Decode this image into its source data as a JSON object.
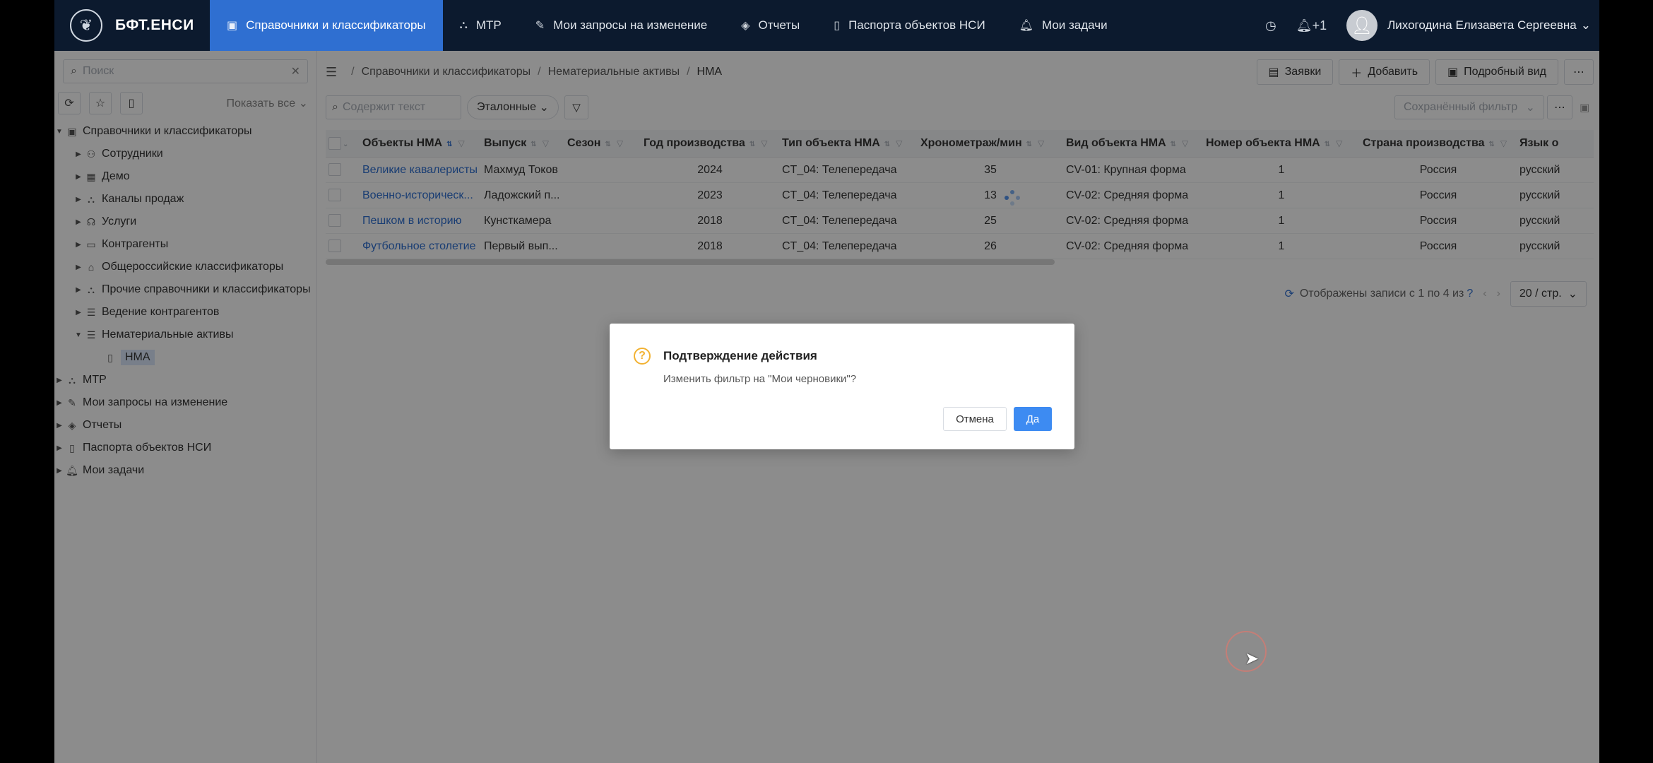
{
  "app": {
    "logo": "БФТ.ЕНСИ"
  },
  "nav": [
    {
      "label": "Справочники и классификаторы",
      "icon": "book-icon",
      "active": true
    },
    {
      "label": "МТР",
      "icon": "hierarchy-icon",
      "active": false
    },
    {
      "label": "Мои запросы на изменение",
      "icon": "edit-doc-icon",
      "active": false
    },
    {
      "label": "Отчеты",
      "icon": "cube-icon",
      "active": false
    },
    {
      "label": "Паспорта объектов НСИ",
      "icon": "document-icon",
      "active": false
    },
    {
      "label": "Мои задачи",
      "icon": "bell-icon",
      "active": false
    }
  ],
  "topright": {
    "notifications": "+1",
    "username": "Лихогодина Елизавета Сергеевна"
  },
  "sidebar": {
    "search_placeholder": "Поиск",
    "show_all": "Показать все",
    "tree": [
      {
        "label": "Справочники и классификаторы",
        "level": 0,
        "expanded": true,
        "icon": "book-icon"
      },
      {
        "label": "Сотрудники",
        "level": 1,
        "icon": "people-icon"
      },
      {
        "label": "Демо",
        "level": 1,
        "icon": "calendar-icon"
      },
      {
        "label": "Каналы продаж",
        "level": 1,
        "icon": "hierarchy-icon"
      },
      {
        "label": "Услуги",
        "level": 1,
        "icon": "headset-icon"
      },
      {
        "label": "Контрагенты",
        "level": 1,
        "icon": "folder-icon"
      },
      {
        "label": "Общероссийские классификаторы",
        "level": 1,
        "icon": "home-icon"
      },
      {
        "label": "Прочие справочники и классификаторы",
        "level": 1,
        "icon": "hierarchy-icon"
      },
      {
        "label": "Ведение контрагентов",
        "level": 1,
        "icon": "list-icon"
      },
      {
        "label": "Нематериальные активы",
        "level": 1,
        "expanded": true,
        "icon": "list-icon"
      },
      {
        "label": "НМА",
        "level": 2,
        "selected": true,
        "icon": "document-icon"
      },
      {
        "label": "МТР",
        "level": 0,
        "icon": "hierarchy-icon"
      },
      {
        "label": "Мои запросы на изменение",
        "level": 0,
        "icon": "edit-doc-icon"
      },
      {
        "label": "Отчеты",
        "level": 0,
        "icon": "cube-icon"
      },
      {
        "label": "Паспорта объектов НСИ",
        "level": 0,
        "icon": "document-icon"
      },
      {
        "label": "Мои задачи",
        "level": 0,
        "icon": "bell-icon"
      }
    ]
  },
  "breadcrumb": [
    "Справочники и классификаторы",
    "Нематериальные активы",
    "НМА"
  ],
  "actions": {
    "requests": "Заявки",
    "add": "Добавить",
    "detail": "Подробный вид"
  },
  "filters": {
    "search_placeholder": "Содержит текст",
    "etalon": "Эталонные",
    "saved_placeholder": "Сохранённый фильтр"
  },
  "table": {
    "columns": [
      "Объекты НМА",
      "Выпуск",
      "Сезон",
      "Год производства",
      "Тип объекта НМА",
      "Хронометраж/мин",
      "Вид объекта НМА",
      "Номер объекта НМА",
      "Страна производства",
      "Язык о"
    ],
    "rows": [
      [
        "Великие кавалеристы",
        "Махмуд Токов",
        "",
        "2024",
        "CT_04: Телепередача",
        "35",
        "CV-01: Крупная форма",
        "1",
        "Россия",
        "русский"
      ],
      [
        "Военно-историческ...",
        "Ладожский п...",
        "",
        "2023",
        "CT_04: Телепередача",
        "13",
        "CV-02: Средняя форма",
        "1",
        "Россия",
        "русский"
      ],
      [
        "Пешком в историю",
        "Кунсткамера",
        "",
        "2018",
        "CT_04: Телепередача",
        "25",
        "CV-02: Средняя форма",
        "1",
        "Россия",
        "русский"
      ],
      [
        "Футбольное столетие",
        "Первый вып...",
        "",
        "2018",
        "CT_04: Телепередача",
        "26",
        "CV-02: Средняя форма",
        "1",
        "Россия",
        "русский"
      ]
    ]
  },
  "pager": {
    "text": "Отображены записи с 1 по 4 из",
    "q": "?",
    "size": "20 / стр."
  },
  "modal": {
    "title": "Подтверждение действия",
    "text": "Изменить фильтр на \"Мои черновики\"?",
    "cancel": "Отмена",
    "ok": "Да"
  }
}
